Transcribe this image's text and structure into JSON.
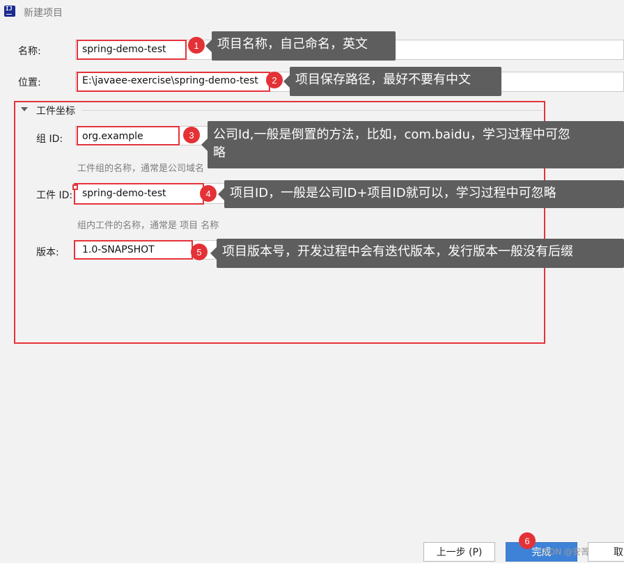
{
  "window": {
    "title": "新建项目"
  },
  "form": {
    "name_label": "名称:",
    "name_value": "spring-demo-test",
    "location_label": "位置:",
    "location_value": "E:\\javaee-exercise\\spring-demo-test",
    "section_title": "工件坐标",
    "group_label": "组 ID:",
    "group_value": "org.example",
    "group_hint": "工件组的名称，通常是公司域名",
    "artifact_label": "工件 ID:",
    "artifact_value": "spring-demo-test",
    "artifact_hint": "组内工件的名称，通常是 项目 名称",
    "version_label": "版本:",
    "version_value": "1.0-SNAPSHOT"
  },
  "annotations": [
    {
      "number": "1",
      "text": "项目名称，自己命名，英文"
    },
    {
      "number": "2",
      "text": "项目保存路径，最好不要有中文"
    },
    {
      "number": "3",
      "text_line1": "公司Id,一般是倒置的方法，比如，com.baidu，学习过程中可忽",
      "text_line2": "略"
    },
    {
      "number": "4",
      "text": "项目ID，一般是公司ID+项目ID就可以，学习过程中可忽略"
    },
    {
      "number": "5",
      "text": "项目版本号，开发过程中会有迭代版本，发行版本一般没有后缀"
    },
    {
      "number": "6"
    }
  ],
  "buttons": {
    "prev": "上一步 (P)",
    "finish": "完成",
    "cancel": "取"
  },
  "watermark": "CSDN @安菁",
  "colors": {
    "annotation_red": "#e5323a",
    "tip_bg": "#5e5e5e",
    "primary_button": "#3e82d8"
  }
}
